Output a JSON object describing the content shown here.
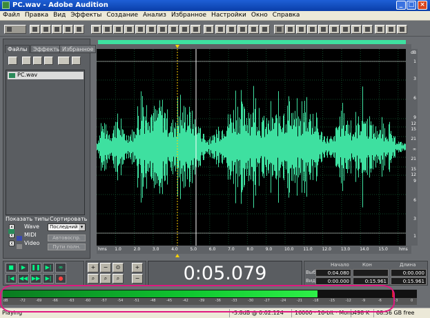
{
  "window": {
    "title": "PC.wav - Adobe Audition"
  },
  "menu": [
    "Файл",
    "Правка",
    "Вид",
    "Эффекты",
    "Создание",
    "Анализ",
    "Избранное",
    "Настройки",
    "Окно",
    "Справка"
  ],
  "panel": {
    "tabs": [
      "Файлы",
      "Эффекты",
      "Избранное"
    ],
    "files": [
      "PC.wav"
    ],
    "show_types_label": "Показать типы",
    "sort_label": "Сортировать",
    "types": [
      "Wave",
      "MIDI",
      "Video"
    ],
    "sort_value": "Последний",
    "autoplay": "Автовоспр.",
    "full_paths": "Пути полн."
  },
  "db_scale": [
    "dB",
    "1",
    "3",
    "6",
    "9",
    "12",
    "15",
    "21",
    "∞",
    "21",
    "15",
    "12",
    "9",
    "6",
    "3",
    "1"
  ],
  "time_ruler": [
    "hms",
    "1.0",
    "2.0",
    "3.0",
    "4.0",
    "5.0",
    "6.0",
    "7.0",
    "8.0",
    "9.0",
    "10.0",
    "11.0",
    "12.0",
    "13.0",
    "14.0",
    "15.0",
    "hms"
  ],
  "time_display": "0:05.079",
  "selection": {
    "headers": [
      "Начало",
      "Кон",
      "Длина"
    ],
    "rows": [
      {
        "label": "Выб",
        "begin": "0:04.080",
        "end": "",
        "length": "0:00.000"
      },
      {
        "label": "Вид",
        "begin": "0:00.000",
        "end": "0:15.961",
        "length": "0:15.961"
      }
    ]
  },
  "meter": {
    "level_fraction": 0.76,
    "scale": [
      "dB",
      "-72",
      "-69",
      "-66",
      "-63",
      "-60",
      "-57",
      "-54",
      "-51",
      "-48",
      "-45",
      "-42",
      "-39",
      "-36",
      "-33",
      "-30",
      "-27",
      "-24",
      "-21",
      "-18",
      "-15",
      "-12",
      "-9",
      "-6",
      "-3",
      "0"
    ]
  },
  "status": {
    "state": "Playing",
    "level": "-3.8dB @",
    "time": "0:02.124",
    "format": "16000 · 16-bit · Mono",
    "size": "498 K",
    "free": "68.56 GB free"
  },
  "colors": {
    "wave": "#3ee0a0",
    "accent": "#e0187f",
    "titlebar": "#0a3ea8"
  }
}
